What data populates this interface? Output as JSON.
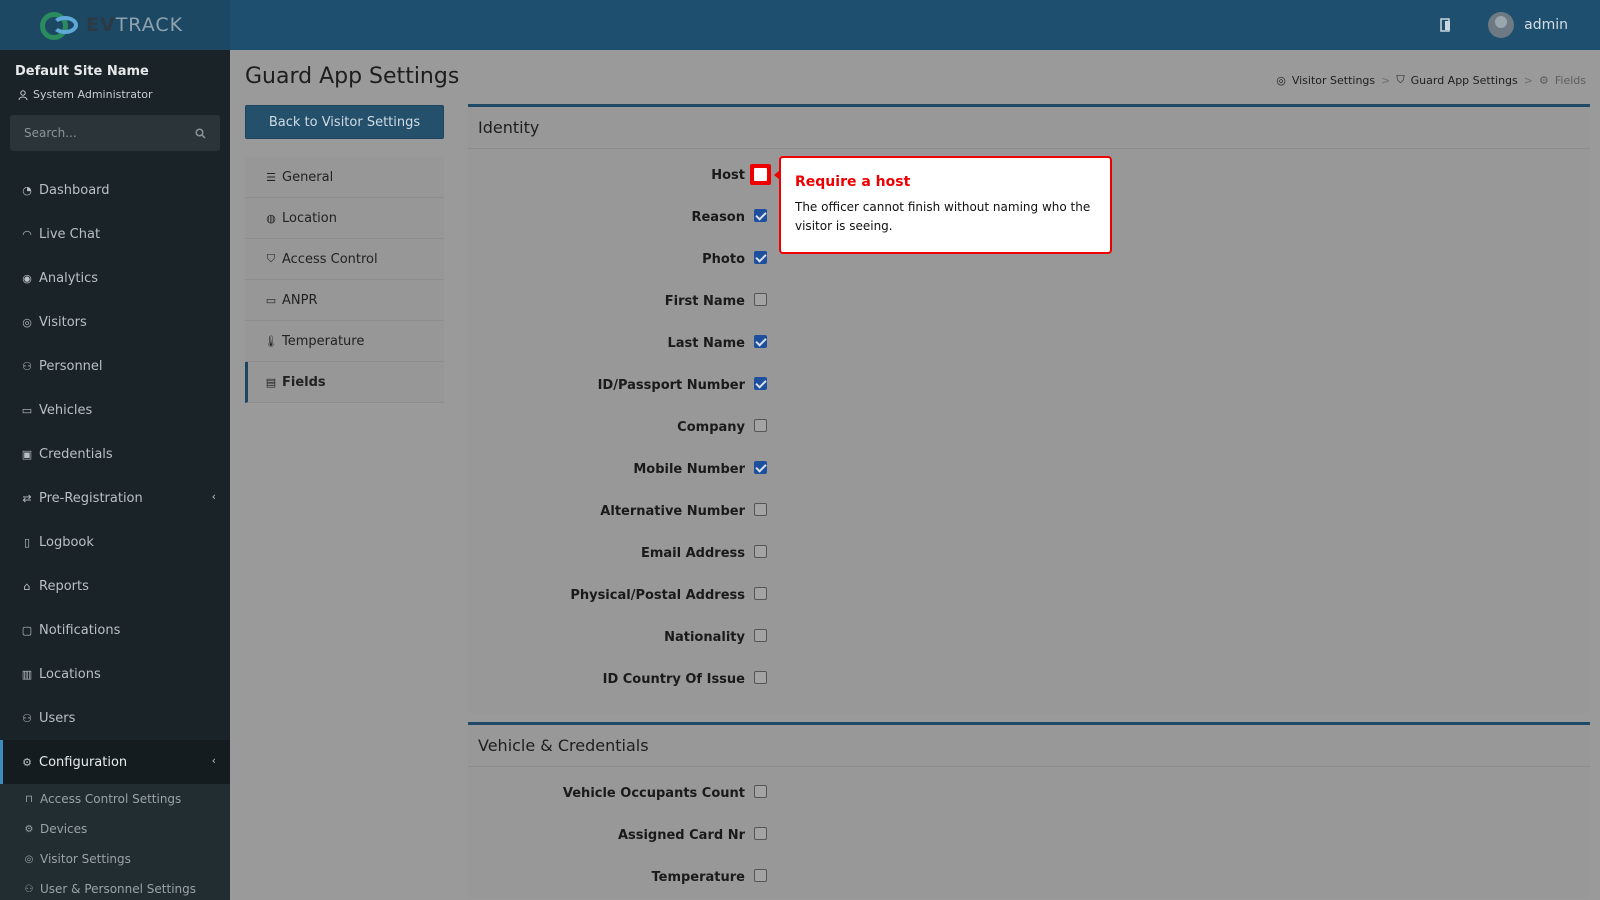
{
  "brand": {
    "name_bold": "EV",
    "name_light": "TRACK"
  },
  "topbar": {
    "user": "admin",
    "icon": "door-icon"
  },
  "sidebar": {
    "site_name": "Default Site Name",
    "role": "System Administrator",
    "search_placeholder": "Search...",
    "items": [
      {
        "label": "Dashboard",
        "icon": "dashboard-icon"
      },
      {
        "label": "Live Chat",
        "icon": "headset-icon"
      },
      {
        "label": "Analytics",
        "icon": "analytics-icon"
      },
      {
        "label": "Visitors",
        "icon": "eye-icon"
      },
      {
        "label": "Personnel",
        "icon": "people-icon"
      },
      {
        "label": "Vehicles",
        "icon": "car-icon"
      },
      {
        "label": "Credentials",
        "icon": "id-card-icon"
      },
      {
        "label": "Pre-Registration",
        "icon": "arrows-icon"
      },
      {
        "label": "Logbook",
        "icon": "book-icon"
      },
      {
        "label": "Reports",
        "icon": "chart-icon"
      },
      {
        "label": "Notifications",
        "icon": "chat-icon"
      },
      {
        "label": "Locations",
        "icon": "map-icon"
      },
      {
        "label": "Users",
        "icon": "users-icon"
      },
      {
        "label": "Configuration",
        "icon": "gear-icon"
      }
    ],
    "sub_items": [
      {
        "label": "Access Control Settings",
        "icon": "lock-icon"
      },
      {
        "label": "Devices",
        "icon": "gear-icon"
      },
      {
        "label": "Visitor Settings",
        "icon": "eye-icon"
      },
      {
        "label": "User & Personnel Settings",
        "icon": "users-icon"
      }
    ]
  },
  "page": {
    "title": "Guard App Settings",
    "back_button": "Back to Visitor Settings",
    "breadcrumb": [
      "Visitor Settings",
      "Guard App Settings",
      "Fields"
    ]
  },
  "tabs": [
    {
      "label": "General",
      "icon": "sliders-icon"
    },
    {
      "label": "Location",
      "icon": "pin-icon"
    },
    {
      "label": "Access Control",
      "icon": "shield-icon"
    },
    {
      "label": "ANPR",
      "icon": "car-icon"
    },
    {
      "label": "Temperature",
      "icon": "thermometer-icon"
    },
    {
      "label": "Fields",
      "icon": "form-icon"
    }
  ],
  "identity": {
    "title": "Identity",
    "fields": [
      {
        "label": "Host",
        "checked": false
      },
      {
        "label": "Reason",
        "checked": true
      },
      {
        "label": "Photo",
        "checked": true
      },
      {
        "label": "First Name",
        "checked": false
      },
      {
        "label": "Last Name",
        "checked": true
      },
      {
        "label": "ID/Passport Number",
        "checked": true
      },
      {
        "label": "Company",
        "checked": false
      },
      {
        "label": "Mobile Number",
        "checked": true
      },
      {
        "label": "Alternative Number",
        "checked": false
      },
      {
        "label": "Email Address",
        "checked": false
      },
      {
        "label": "Physical/Postal Address",
        "checked": false
      },
      {
        "label": "Nationality",
        "checked": false
      },
      {
        "label": "ID Country Of Issue",
        "checked": false
      }
    ]
  },
  "vehicle": {
    "title": "Vehicle & Credentials",
    "fields": [
      {
        "label": "Vehicle Occupants Count",
        "checked": false
      },
      {
        "label": "Assigned Card Nr",
        "checked": false
      },
      {
        "label": "Temperature",
        "checked": false
      }
    ]
  },
  "tooltip": {
    "title": "Require a host",
    "body": "The officer cannot finish without naming who the visitor is seeing."
  },
  "colors": {
    "accent": "#1f4a65",
    "highlight": "#ee0000",
    "checkbox": "#1e4f9c"
  }
}
